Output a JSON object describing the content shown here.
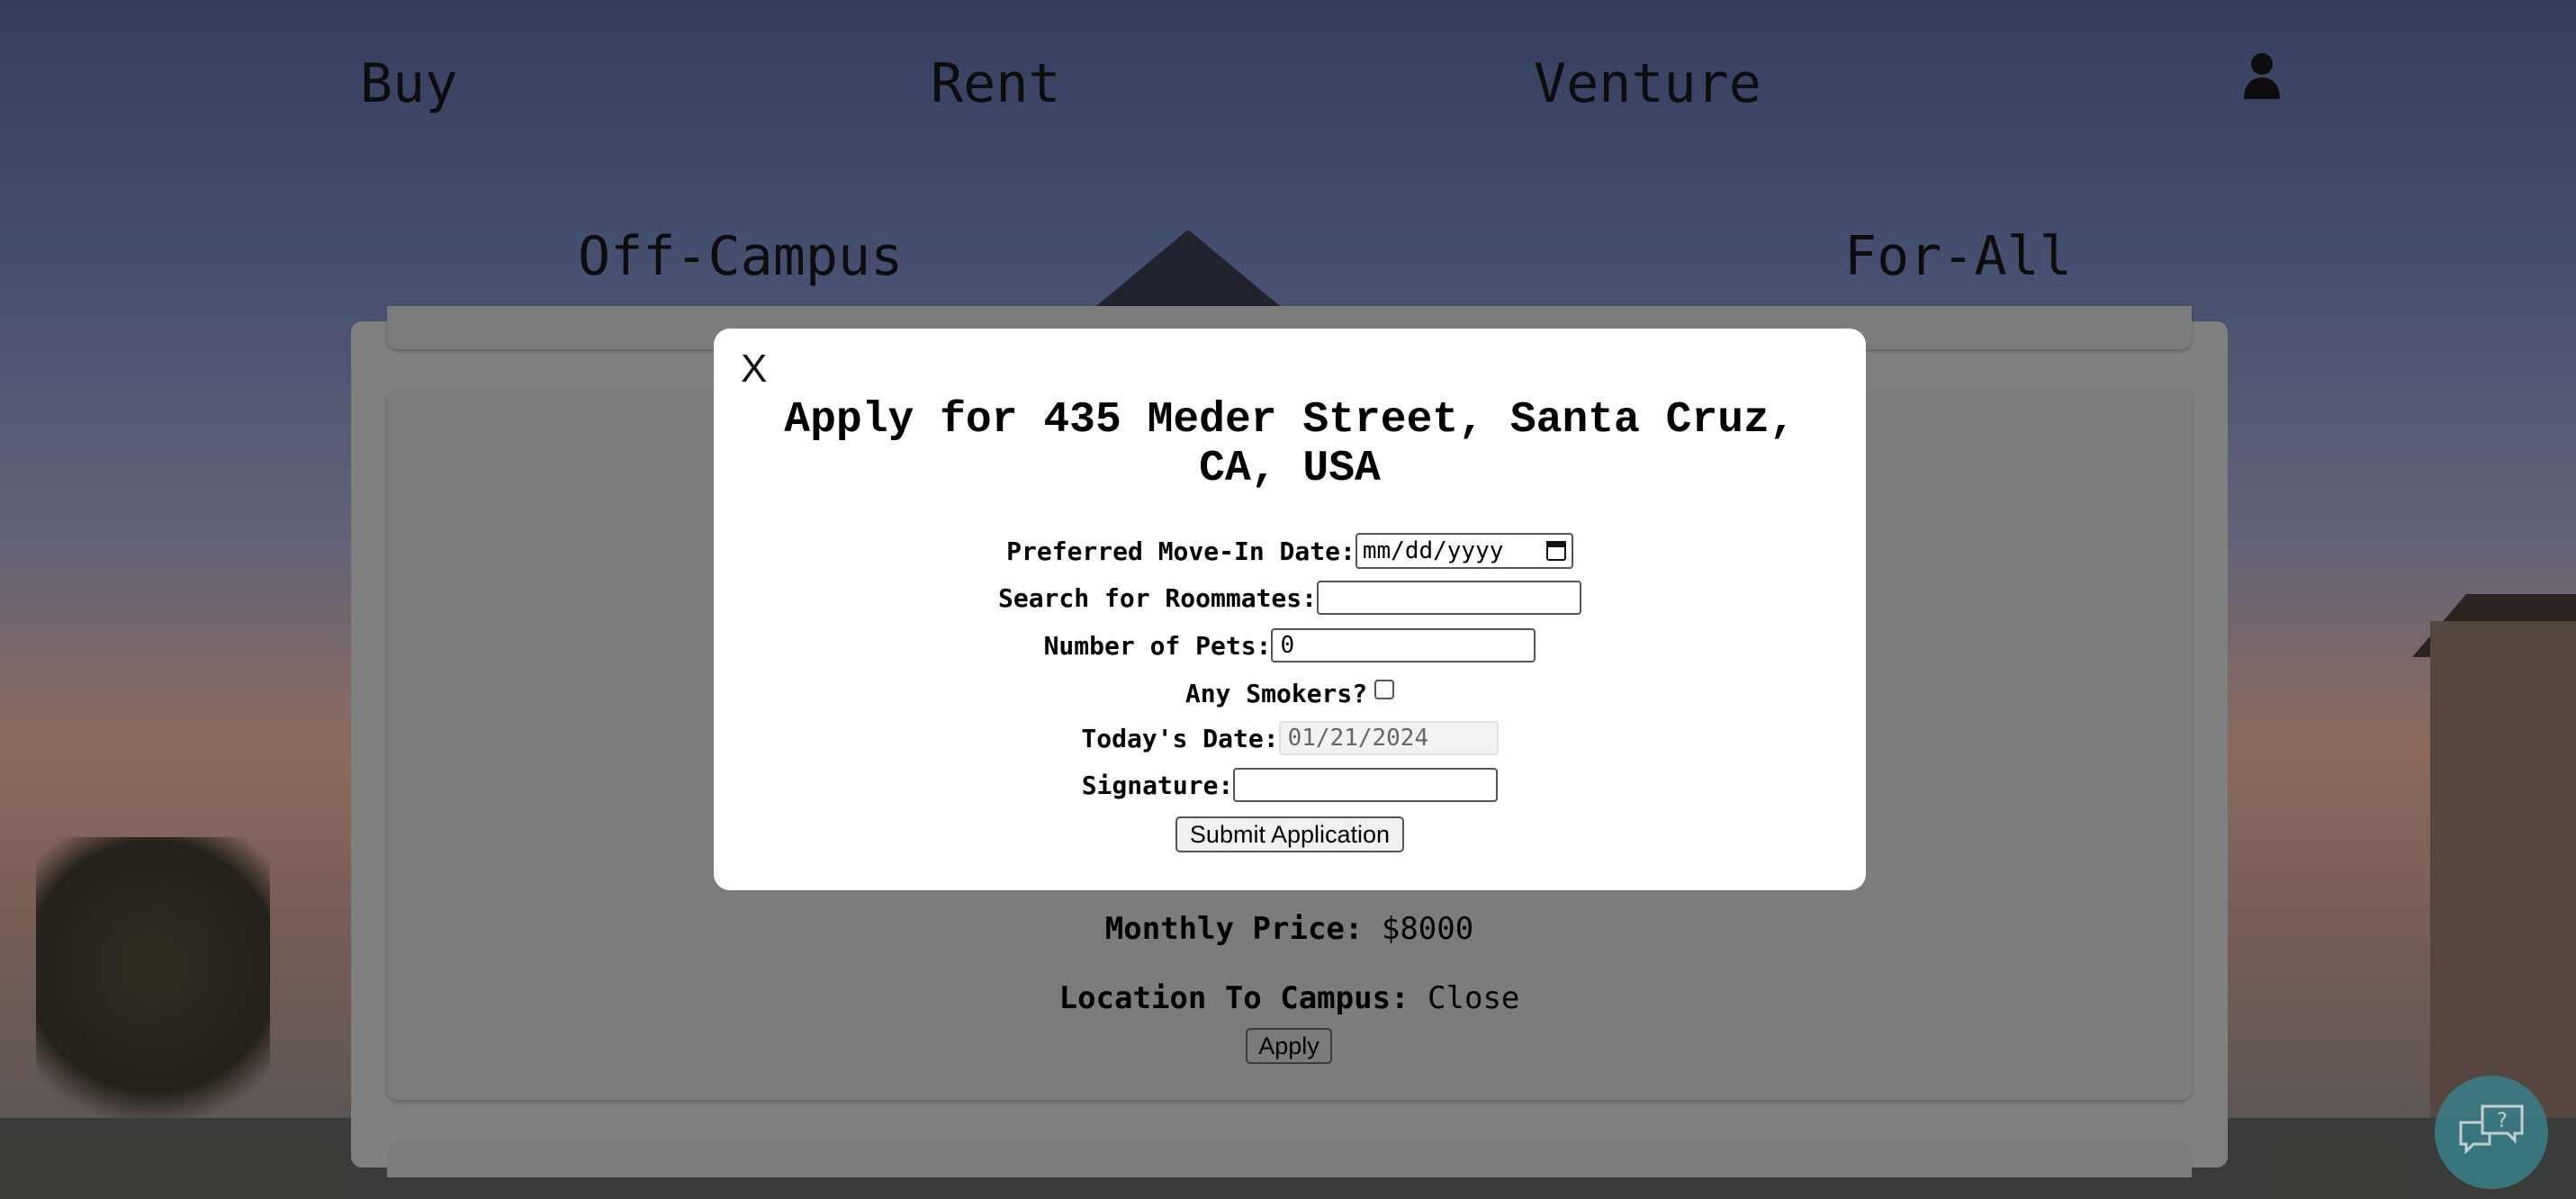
{
  "nav": {
    "buy": "Buy",
    "rent": "Rent",
    "venture": "Venture",
    "off_campus": "Off-Campus",
    "for_all": "For-All",
    "user_icon": "user-icon"
  },
  "listing": {
    "monthly_price_label": "Monthly Price:",
    "monthly_price_value": "$8000",
    "location_label": "Location To Campus:",
    "location_value": "Close",
    "apply_label": "Apply"
  },
  "modal": {
    "close_label": "X",
    "title": "Apply for 435 Meder Street, Santa Cruz, CA, USA",
    "move_in_label": "Preferred Move-In Date:",
    "move_in_placeholder": "mm/dd/yyyy",
    "roommates_label": "Search for Roommates:",
    "roommates_value": "",
    "pets_label": "Number of Pets:",
    "pets_value": "0",
    "smokers_label": "Any Smokers?",
    "smokers_checked": false,
    "today_label": "Today's Date:",
    "today_value": "01/21/2024",
    "signature_label": "Signature:",
    "signature_value": "",
    "submit_label": "Submit Application"
  },
  "chat": {
    "icon": "chat-help-icon"
  }
}
